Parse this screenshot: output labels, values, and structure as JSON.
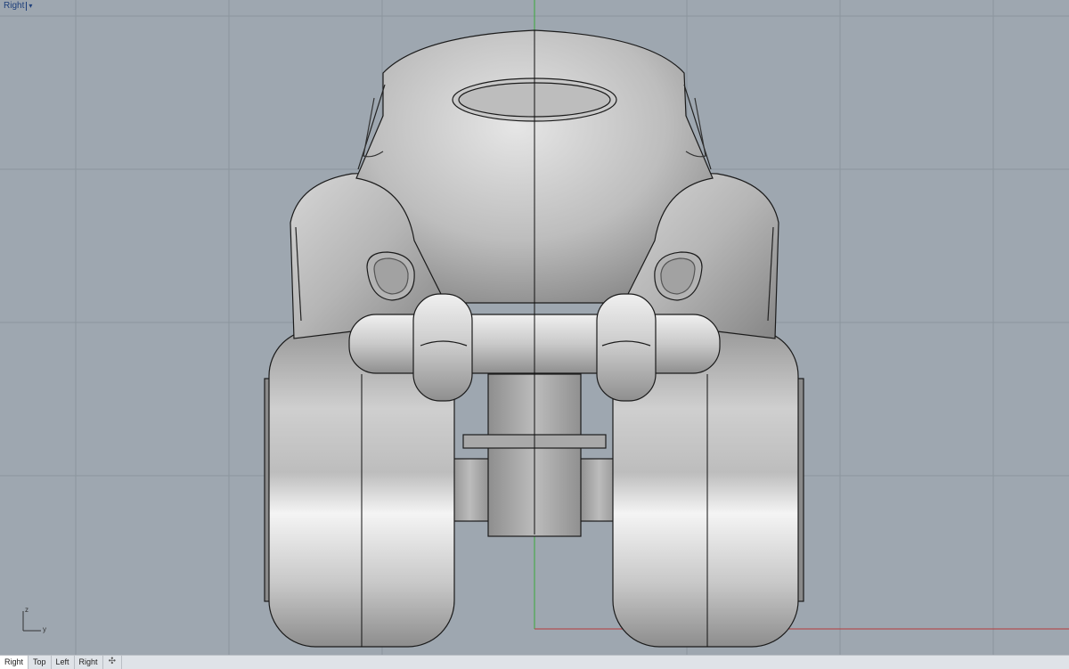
{
  "viewport": {
    "title": "Right",
    "title_menu_icon": "dropdown-caret-icon",
    "background_color": "#9ea7b0",
    "grid_color": "#8c959e",
    "axis_colors": {
      "x": "#b53a3a",
      "z": "#3aa83a"
    },
    "axis_labels": {
      "z": "z",
      "y": "y"
    }
  },
  "tabs": [
    {
      "label": "Right",
      "active": true
    },
    {
      "label": "Top",
      "active": false
    },
    {
      "label": "Left",
      "active": false
    },
    {
      "label": "Right",
      "active": false
    }
  ],
  "add_tab_icon": "plus-icon"
}
